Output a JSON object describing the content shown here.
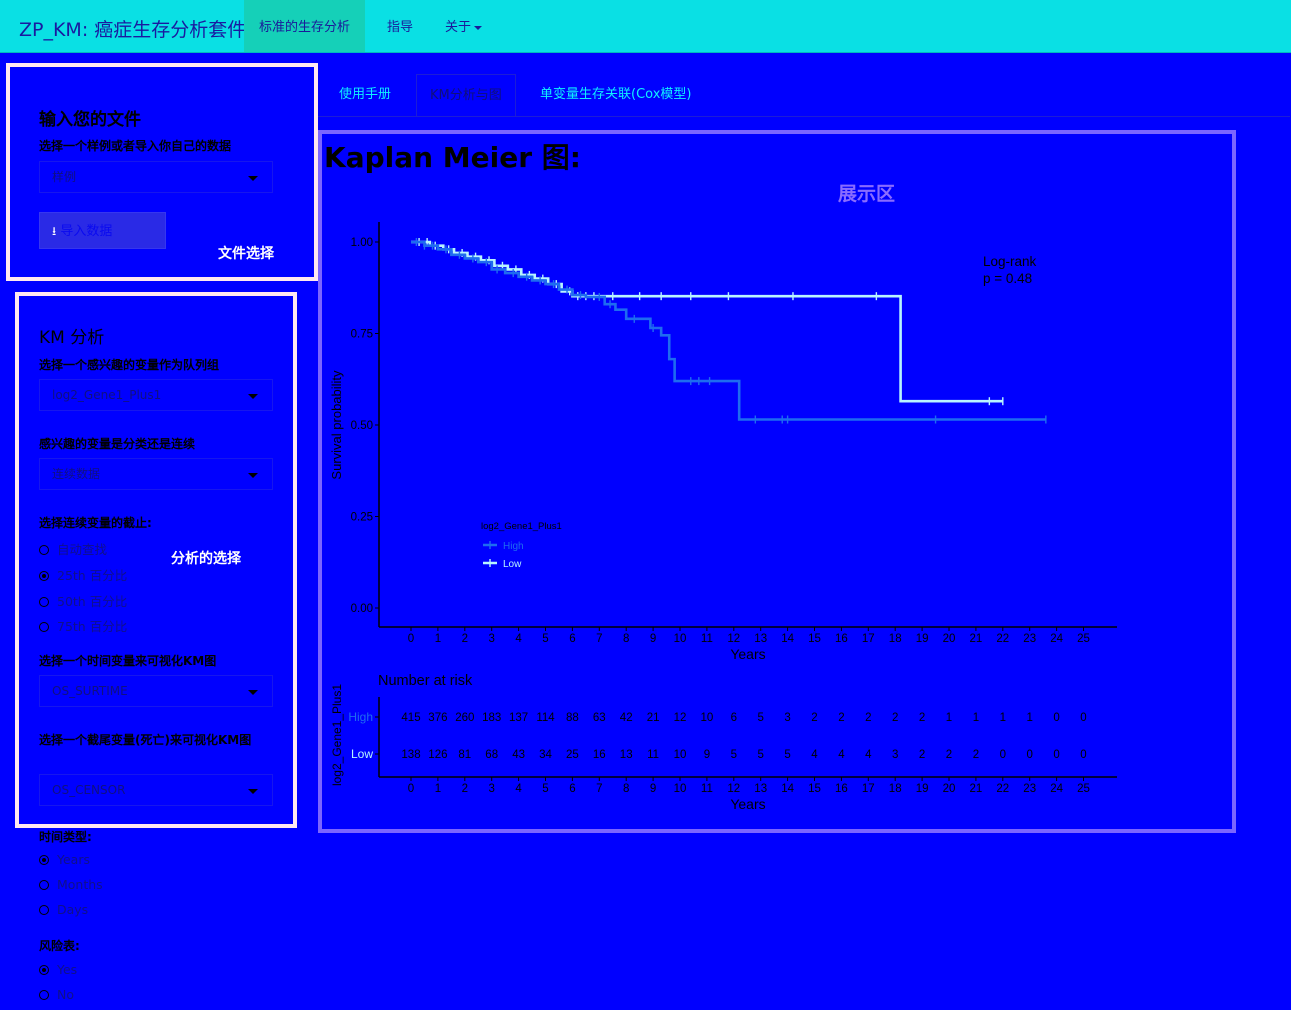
{
  "navbar": {
    "brand": "ZP_KM: 癌症生存分析套件",
    "items": [
      {
        "label": "标准的生存分析"
      },
      {
        "label": "指导"
      },
      {
        "label": "关于"
      }
    ]
  },
  "file_panel": {
    "title": "输入您的文件",
    "select_label": "选择一个样例或者导入你自己的数据",
    "select_value": "样例",
    "upload_button": "导入数据",
    "note": "文件选择"
  },
  "km_panel": {
    "title": "KM 分析",
    "note": "分析的选择",
    "var_label": "选择一个感兴趣的变量作为队列组",
    "var_value": "log2_Gene1_Plus1",
    "type_label": "感兴趣的变量是分类还是连续",
    "type_value": "连续数据",
    "cut_label": "选择连续变量的截止:",
    "cut_options": [
      {
        "label": "自动查找",
        "checked": false
      },
      {
        "label": "25th 百分比",
        "checked": true
      },
      {
        "label": "50th 百分比",
        "checked": false
      },
      {
        "label": "75th 百分比",
        "checked": false
      }
    ],
    "time_label": "选择一个时间变量来可视化KM图",
    "time_value": "OS_SURTIME",
    "censor_label": "选择一个截尾变量(死亡)来可视化KM图",
    "censor_value": "OS_CENSOR"
  },
  "below_panel": {
    "time_type_label": "时间类型:",
    "time_types": [
      {
        "label": "Years",
        "checked": true
      },
      {
        "label": "Months",
        "checked": false
      },
      {
        "label": "Days",
        "checked": false
      }
    ],
    "risk_label": "风险表:",
    "risk_options": [
      {
        "label": "Yes",
        "checked": true
      },
      {
        "label": "No",
        "checked": false
      }
    ]
  },
  "tabs": [
    {
      "label": "使用手册"
    },
    {
      "label": "KM分析与图"
    },
    {
      "label": "单变量生存关联(Cox模型)"
    }
  ],
  "main": {
    "heading": "Kaplan Meier 图:",
    "area_label": "展示区"
  },
  "colors": {
    "background": "#0000ff",
    "navbar": "#0ae0e4",
    "nav_active": "#15d0b8",
    "panel_border": "#ffe8f0",
    "display_border": "#7b66ff",
    "high_line": "#1e6cf0",
    "low_line": "#b8f4ff"
  },
  "chart_data": {
    "type": "line",
    "title": "",
    "xlabel": "Years",
    "ylabel": "Survival probability",
    "xlim": [
      -1.5,
      26.5
    ],
    "ylim": [
      0,
      1
    ],
    "x_ticks": [
      "0",
      "1",
      "2",
      "3",
      "4",
      "5",
      "6",
      "7",
      "8",
      "9",
      "10",
      "11",
      "12",
      "13",
      "14",
      "15",
      "16",
      "17",
      "18",
      "19",
      "20",
      "21",
      "22",
      "23",
      "24",
      "25"
    ],
    "y_ticks": [
      "0.00",
      "0.25",
      "0.50",
      "0.75",
      "1.00"
    ],
    "annotation": [
      "Log-rank",
      "p = 0.48"
    ],
    "legend_title": "log2_Gene1_Plus1",
    "legend_position": "inside-left",
    "series": [
      {
        "name": "High",
        "color": "#1e6cf0",
        "steps": [
          [
            0,
            1.0
          ],
          [
            0.5,
            0.99
          ],
          [
            1.0,
            0.98
          ],
          [
            1.5,
            0.965
          ],
          [
            2.0,
            0.955
          ],
          [
            2.5,
            0.945
          ],
          [
            3.0,
            0.925
          ],
          [
            3.5,
            0.915
          ],
          [
            4.0,
            0.905
          ],
          [
            4.5,
            0.895
          ],
          [
            5.0,
            0.885
          ],
          [
            5.5,
            0.87
          ],
          [
            6.0,
            0.855
          ],
          [
            6.5,
            0.85
          ],
          [
            7.2,
            0.83
          ],
          [
            7.6,
            0.815
          ],
          [
            8.0,
            0.79
          ],
          [
            8.9,
            0.765
          ],
          [
            9.3,
            0.745
          ],
          [
            9.6,
            0.68
          ],
          [
            9.8,
            0.62
          ],
          [
            12.1,
            0.62
          ],
          [
            12.2,
            0.515
          ],
          [
            23.6,
            0.515
          ]
        ],
        "censor_x": [
          0.2,
          0.5,
          0.8,
          1.3,
          1.8,
          2.3,
          2.8,
          3.2,
          3.8,
          4.3,
          4.8,
          5.3,
          5.8,
          6.3,
          7.0,
          7.4,
          8.3,
          9.0,
          10.4,
          10.7,
          11.1,
          12.8,
          13.8,
          14.0,
          19.5,
          23.6
        ]
      },
      {
        "name": "Low",
        "color": "#b8f4ff",
        "steps": [
          [
            0,
            1.0
          ],
          [
            0.7,
            0.99
          ],
          [
            1.2,
            0.98
          ],
          [
            1.6,
            0.97
          ],
          [
            2.1,
            0.96
          ],
          [
            2.6,
            0.95
          ],
          [
            3.1,
            0.935
          ],
          [
            3.6,
            0.925
          ],
          [
            4.1,
            0.91
          ],
          [
            4.6,
            0.9
          ],
          [
            5.1,
            0.885
          ],
          [
            5.6,
            0.865
          ],
          [
            6.0,
            0.852
          ],
          [
            18.1,
            0.852
          ],
          [
            18.2,
            0.565
          ],
          [
            22.0,
            0.565
          ]
        ],
        "censor_x": [
          0.3,
          0.6,
          0.9,
          1.4,
          1.9,
          2.4,
          2.9,
          3.4,
          3.9,
          4.4,
          4.9,
          5.4,
          5.9,
          6.2,
          6.5,
          6.8,
          7.5,
          8.5,
          9.3,
          10.4,
          11.8,
          14.2,
          17.3,
          21.5,
          22.0
        ]
      }
    ],
    "risk_table": {
      "title": "Number at risk",
      "ylabel": "log2_Gene1_Plus1",
      "xlabel": "Years",
      "x": [
        "0",
        "1",
        "2",
        "3",
        "4",
        "5",
        "6",
        "7",
        "8",
        "9",
        "10",
        "11",
        "12",
        "13",
        "14",
        "15",
        "16",
        "17",
        "18",
        "19",
        "20",
        "21",
        "22",
        "23",
        "24",
        "25"
      ],
      "rows": [
        {
          "name": "High",
          "values": [
            "415",
            "376",
            "260",
            "183",
            "137",
            "114",
            "88",
            "63",
            "42",
            "21",
            "12",
            "10",
            "6",
            "5",
            "3",
            "2",
            "2",
            "2",
            "2",
            "2",
            "1",
            "1",
            "1",
            "1",
            "0",
            "0"
          ]
        },
        {
          "name": "Low",
          "values": [
            "138",
            "126",
            "81",
            "68",
            "43",
            "34",
            "25",
            "16",
            "13",
            "11",
            "10",
            "9",
            "5",
            "5",
            "5",
            "4",
            "4",
            "4",
            "3",
            "2",
            "2",
            "2",
            "0",
            "0",
            "0",
            "0"
          ]
        }
      ]
    }
  }
}
